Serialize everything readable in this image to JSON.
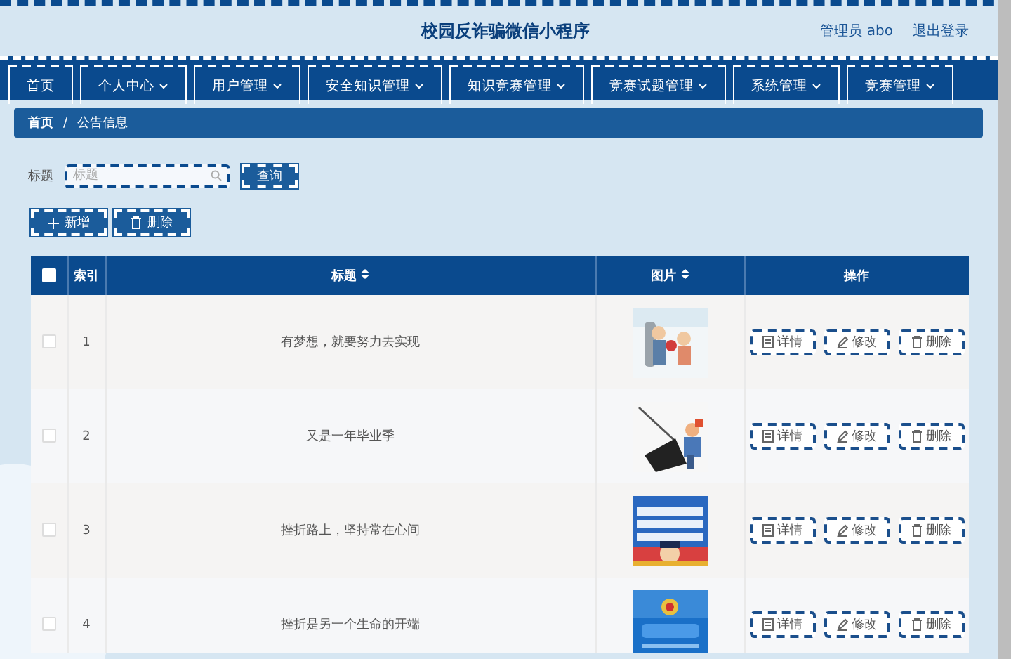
{
  "header": {
    "title": "校园反诈骗微信小程序",
    "user": "管理员 abo",
    "logout": "退出登录"
  },
  "nav": [
    {
      "label": "首页",
      "dropdown": false
    },
    {
      "label": "个人中心",
      "dropdown": true
    },
    {
      "label": "用户管理",
      "dropdown": true
    },
    {
      "label": "安全知识管理",
      "dropdown": true
    },
    {
      "label": "知识竞赛管理",
      "dropdown": true
    },
    {
      "label": "竞赛试题管理",
      "dropdown": true
    },
    {
      "label": "系统管理",
      "dropdown": true
    },
    {
      "label": "竞赛管理",
      "dropdown": true
    }
  ],
  "breadcrumb": {
    "items": [
      "首页",
      "公告信息"
    ],
    "separator": "/"
  },
  "search": {
    "label": "标题",
    "placeholder": "标题",
    "button": "查询"
  },
  "toolbar": [
    {
      "label": "新增",
      "kind": "add"
    },
    {
      "label": "删除",
      "kind": "delete"
    }
  ],
  "table": {
    "columns": [
      {
        "kind": "checkbox",
        "checked": false
      },
      {
        "kind": "text",
        "label": "索引",
        "sortable": false
      },
      {
        "kind": "text",
        "label": "标题",
        "sortable": true
      },
      {
        "kind": "text",
        "label": "图片",
        "sortable": true
      },
      {
        "kind": "text",
        "label": "操作",
        "sortable": false
      }
    ],
    "rows": [
      {
        "checked": false,
        "index": "1",
        "title": "有梦想，就要努力去实现",
        "actions": [
          {
            "label": "详情",
            "kind": "detail"
          },
          {
            "label": "修改",
            "kind": "edit"
          },
          {
            "label": "删除",
            "kind": "delete"
          }
        ]
      },
      {
        "checked": false,
        "index": "2",
        "title": "又是一年毕业季",
        "actions": [
          {
            "label": "详情",
            "kind": "detail"
          },
          {
            "label": "修改",
            "kind": "edit"
          },
          {
            "label": "删除",
            "kind": "delete"
          }
        ]
      },
      {
        "checked": false,
        "index": "3",
        "title": "挫折路上，坚持常在心间",
        "actions": [
          {
            "label": "详情",
            "kind": "detail"
          },
          {
            "label": "修改",
            "kind": "edit"
          },
          {
            "label": "删除",
            "kind": "delete"
          }
        ]
      },
      {
        "checked": false,
        "index": "4",
        "title": "挫折是另一个生命的开端",
        "actions": [
          {
            "label": "详情",
            "kind": "detail"
          },
          {
            "label": "修改",
            "kind": "edit"
          },
          {
            "label": "删除",
            "kind": "delete"
          }
        ]
      }
    ]
  }
}
